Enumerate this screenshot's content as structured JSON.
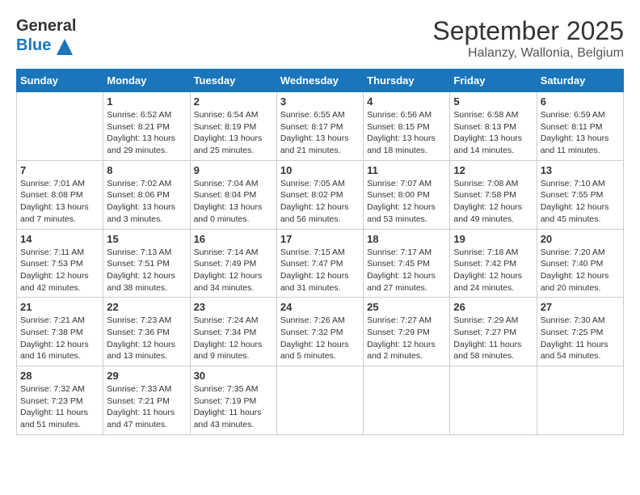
{
  "header": {
    "logo_line1": "General",
    "logo_line2": "Blue",
    "month": "September 2025",
    "location": "Halanzy, Wallonia, Belgium"
  },
  "weekdays": [
    "Sunday",
    "Monday",
    "Tuesday",
    "Wednesday",
    "Thursday",
    "Friday",
    "Saturday"
  ],
  "weeks": [
    [
      {
        "day": "",
        "info": ""
      },
      {
        "day": "1",
        "info": "Sunrise: 6:52 AM\nSunset: 8:21 PM\nDaylight: 13 hours\nand 29 minutes."
      },
      {
        "day": "2",
        "info": "Sunrise: 6:54 AM\nSunset: 8:19 PM\nDaylight: 13 hours\nand 25 minutes."
      },
      {
        "day": "3",
        "info": "Sunrise: 6:55 AM\nSunset: 8:17 PM\nDaylight: 13 hours\nand 21 minutes."
      },
      {
        "day": "4",
        "info": "Sunrise: 6:56 AM\nSunset: 8:15 PM\nDaylight: 13 hours\nand 18 minutes."
      },
      {
        "day": "5",
        "info": "Sunrise: 6:58 AM\nSunset: 8:13 PM\nDaylight: 13 hours\nand 14 minutes."
      },
      {
        "day": "6",
        "info": "Sunrise: 6:59 AM\nSunset: 8:11 PM\nDaylight: 13 hours\nand 11 minutes."
      }
    ],
    [
      {
        "day": "7",
        "info": "Sunrise: 7:01 AM\nSunset: 8:08 PM\nDaylight: 13 hours\nand 7 minutes."
      },
      {
        "day": "8",
        "info": "Sunrise: 7:02 AM\nSunset: 8:06 PM\nDaylight: 13 hours\nand 3 minutes."
      },
      {
        "day": "9",
        "info": "Sunrise: 7:04 AM\nSunset: 8:04 PM\nDaylight: 13 hours\nand 0 minutes."
      },
      {
        "day": "10",
        "info": "Sunrise: 7:05 AM\nSunset: 8:02 PM\nDaylight: 12 hours\nand 56 minutes."
      },
      {
        "day": "11",
        "info": "Sunrise: 7:07 AM\nSunset: 8:00 PM\nDaylight: 12 hours\nand 53 minutes."
      },
      {
        "day": "12",
        "info": "Sunrise: 7:08 AM\nSunset: 7:58 PM\nDaylight: 12 hours\nand 49 minutes."
      },
      {
        "day": "13",
        "info": "Sunrise: 7:10 AM\nSunset: 7:55 PM\nDaylight: 12 hours\nand 45 minutes."
      }
    ],
    [
      {
        "day": "14",
        "info": "Sunrise: 7:11 AM\nSunset: 7:53 PM\nDaylight: 12 hours\nand 42 minutes."
      },
      {
        "day": "15",
        "info": "Sunrise: 7:13 AM\nSunset: 7:51 PM\nDaylight: 12 hours\nand 38 minutes."
      },
      {
        "day": "16",
        "info": "Sunrise: 7:14 AM\nSunset: 7:49 PM\nDaylight: 12 hours\nand 34 minutes."
      },
      {
        "day": "17",
        "info": "Sunrise: 7:15 AM\nSunset: 7:47 PM\nDaylight: 12 hours\nand 31 minutes."
      },
      {
        "day": "18",
        "info": "Sunrise: 7:17 AM\nSunset: 7:45 PM\nDaylight: 12 hours\nand 27 minutes."
      },
      {
        "day": "19",
        "info": "Sunrise: 7:18 AM\nSunset: 7:42 PM\nDaylight: 12 hours\nand 24 minutes."
      },
      {
        "day": "20",
        "info": "Sunrise: 7:20 AM\nSunset: 7:40 PM\nDaylight: 12 hours\nand 20 minutes."
      }
    ],
    [
      {
        "day": "21",
        "info": "Sunrise: 7:21 AM\nSunset: 7:38 PM\nDaylight: 12 hours\nand 16 minutes."
      },
      {
        "day": "22",
        "info": "Sunrise: 7:23 AM\nSunset: 7:36 PM\nDaylight: 12 hours\nand 13 minutes."
      },
      {
        "day": "23",
        "info": "Sunrise: 7:24 AM\nSunset: 7:34 PM\nDaylight: 12 hours\nand 9 minutes."
      },
      {
        "day": "24",
        "info": "Sunrise: 7:26 AM\nSunset: 7:32 PM\nDaylight: 12 hours\nand 5 minutes."
      },
      {
        "day": "25",
        "info": "Sunrise: 7:27 AM\nSunset: 7:29 PM\nDaylight: 12 hours\nand 2 minutes."
      },
      {
        "day": "26",
        "info": "Sunrise: 7:29 AM\nSunset: 7:27 PM\nDaylight: 11 hours\nand 58 minutes."
      },
      {
        "day": "27",
        "info": "Sunrise: 7:30 AM\nSunset: 7:25 PM\nDaylight: 11 hours\nand 54 minutes."
      }
    ],
    [
      {
        "day": "28",
        "info": "Sunrise: 7:32 AM\nSunset: 7:23 PM\nDaylight: 11 hours\nand 51 minutes."
      },
      {
        "day": "29",
        "info": "Sunrise: 7:33 AM\nSunset: 7:21 PM\nDaylight: 11 hours\nand 47 minutes."
      },
      {
        "day": "30",
        "info": "Sunrise: 7:35 AM\nSunset: 7:19 PM\nDaylight: 11 hours\nand 43 minutes."
      },
      {
        "day": "",
        "info": ""
      },
      {
        "day": "",
        "info": ""
      },
      {
        "day": "",
        "info": ""
      },
      {
        "day": "",
        "info": ""
      }
    ]
  ]
}
